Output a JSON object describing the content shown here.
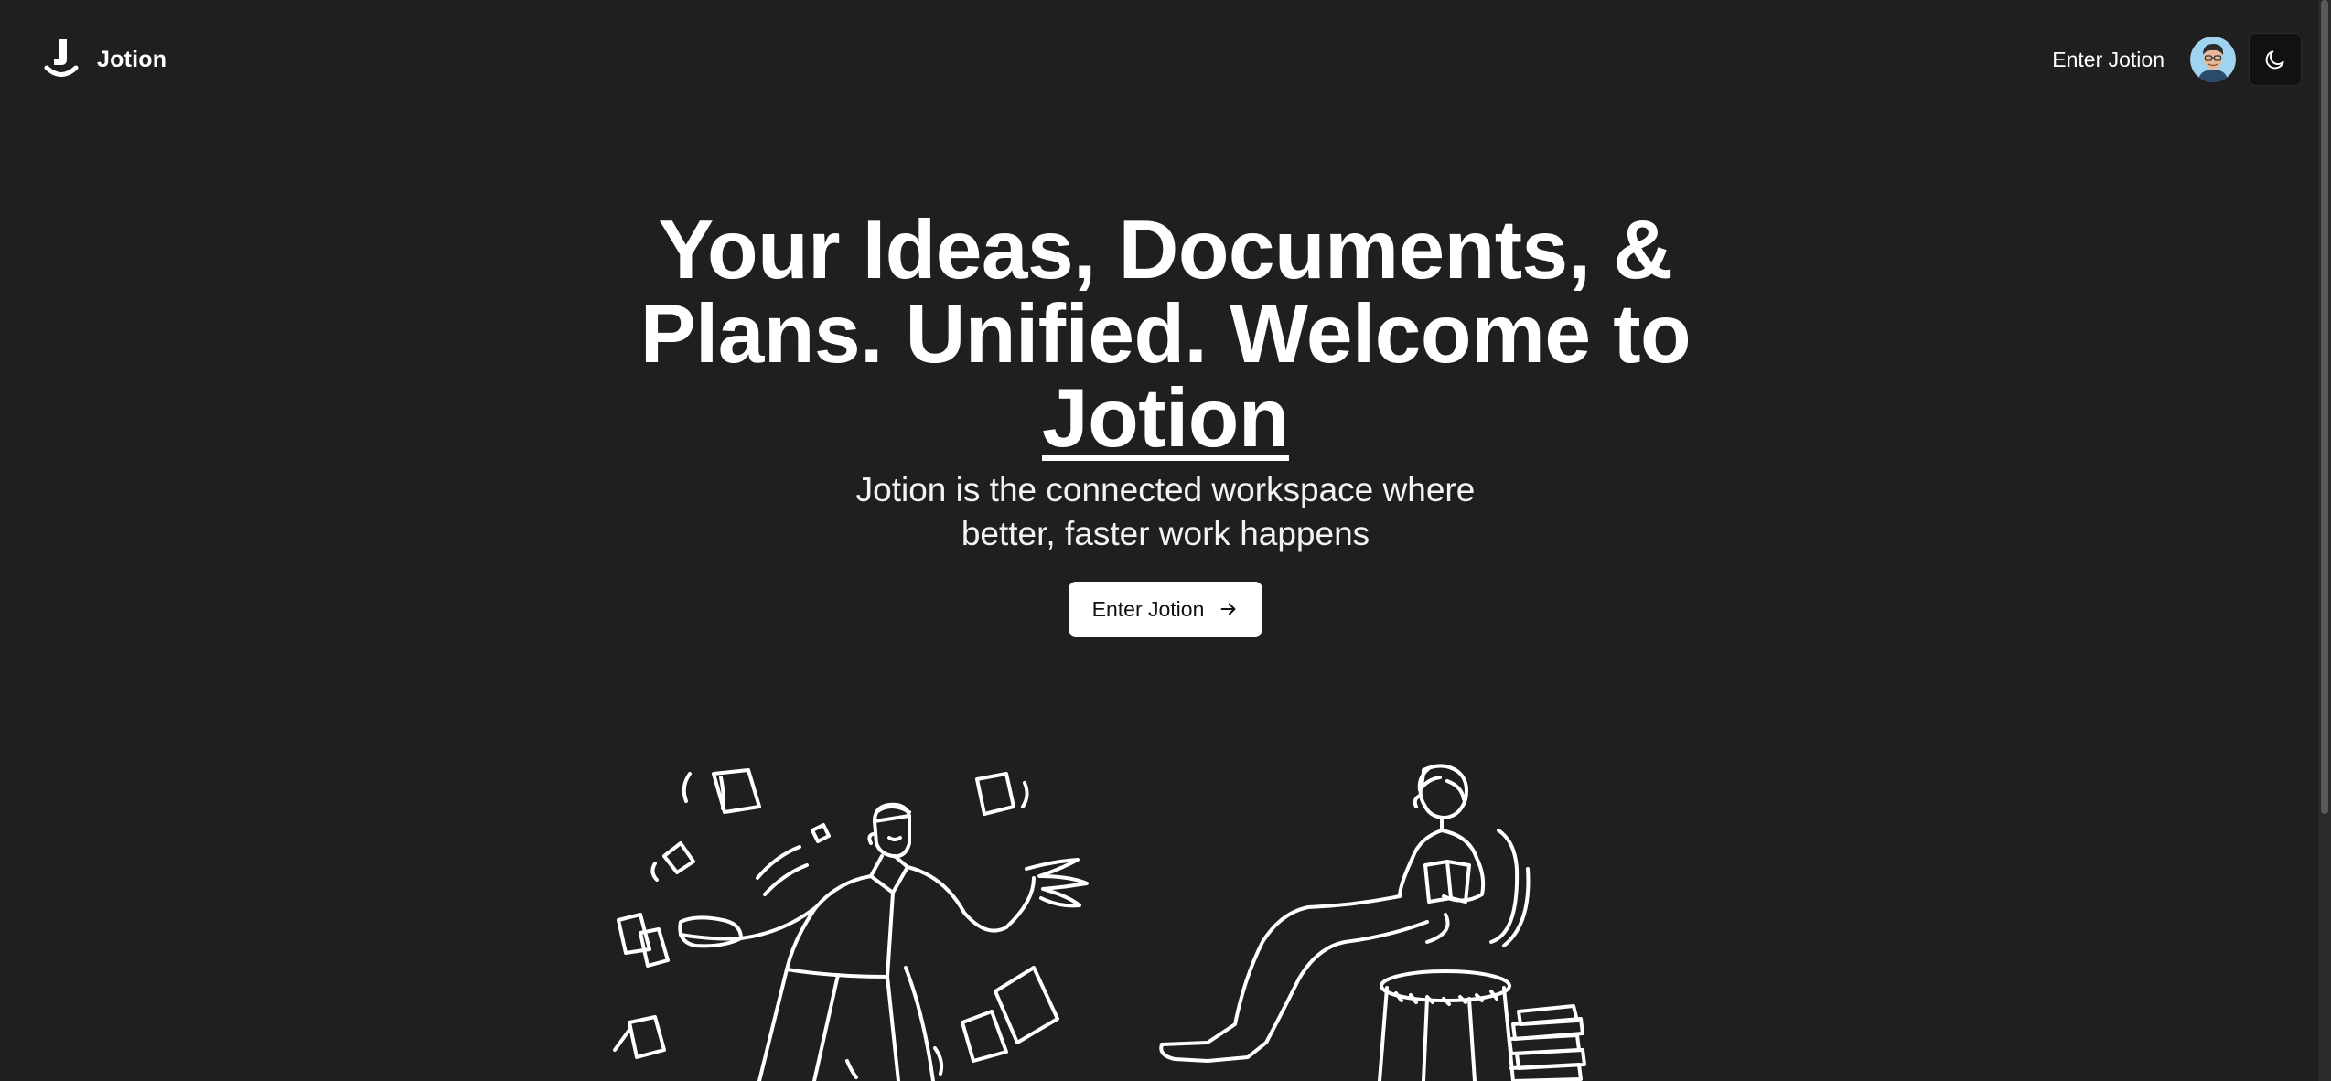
{
  "brand": {
    "name": "Jotion",
    "logo_icon": "jotion-logo-icon"
  },
  "nav": {
    "enter_label": "Enter Jotion",
    "avatar_icon": "user-avatar",
    "theme_icon": "moon-icon"
  },
  "hero": {
    "title_part1": "Your Ideas, Documents, & Plans. Unified. Welcome to ",
    "title_brand": "Jotion",
    "subtitle": "Jotion is the connected workspace where better, faster work happens",
    "cta_label": "Enter Jotion",
    "cta_icon": "arrow-right-icon"
  },
  "colors": {
    "background": "#1f1f1f",
    "text": "#ffffff",
    "cta_bg": "#ffffff",
    "cta_text": "#111111"
  }
}
